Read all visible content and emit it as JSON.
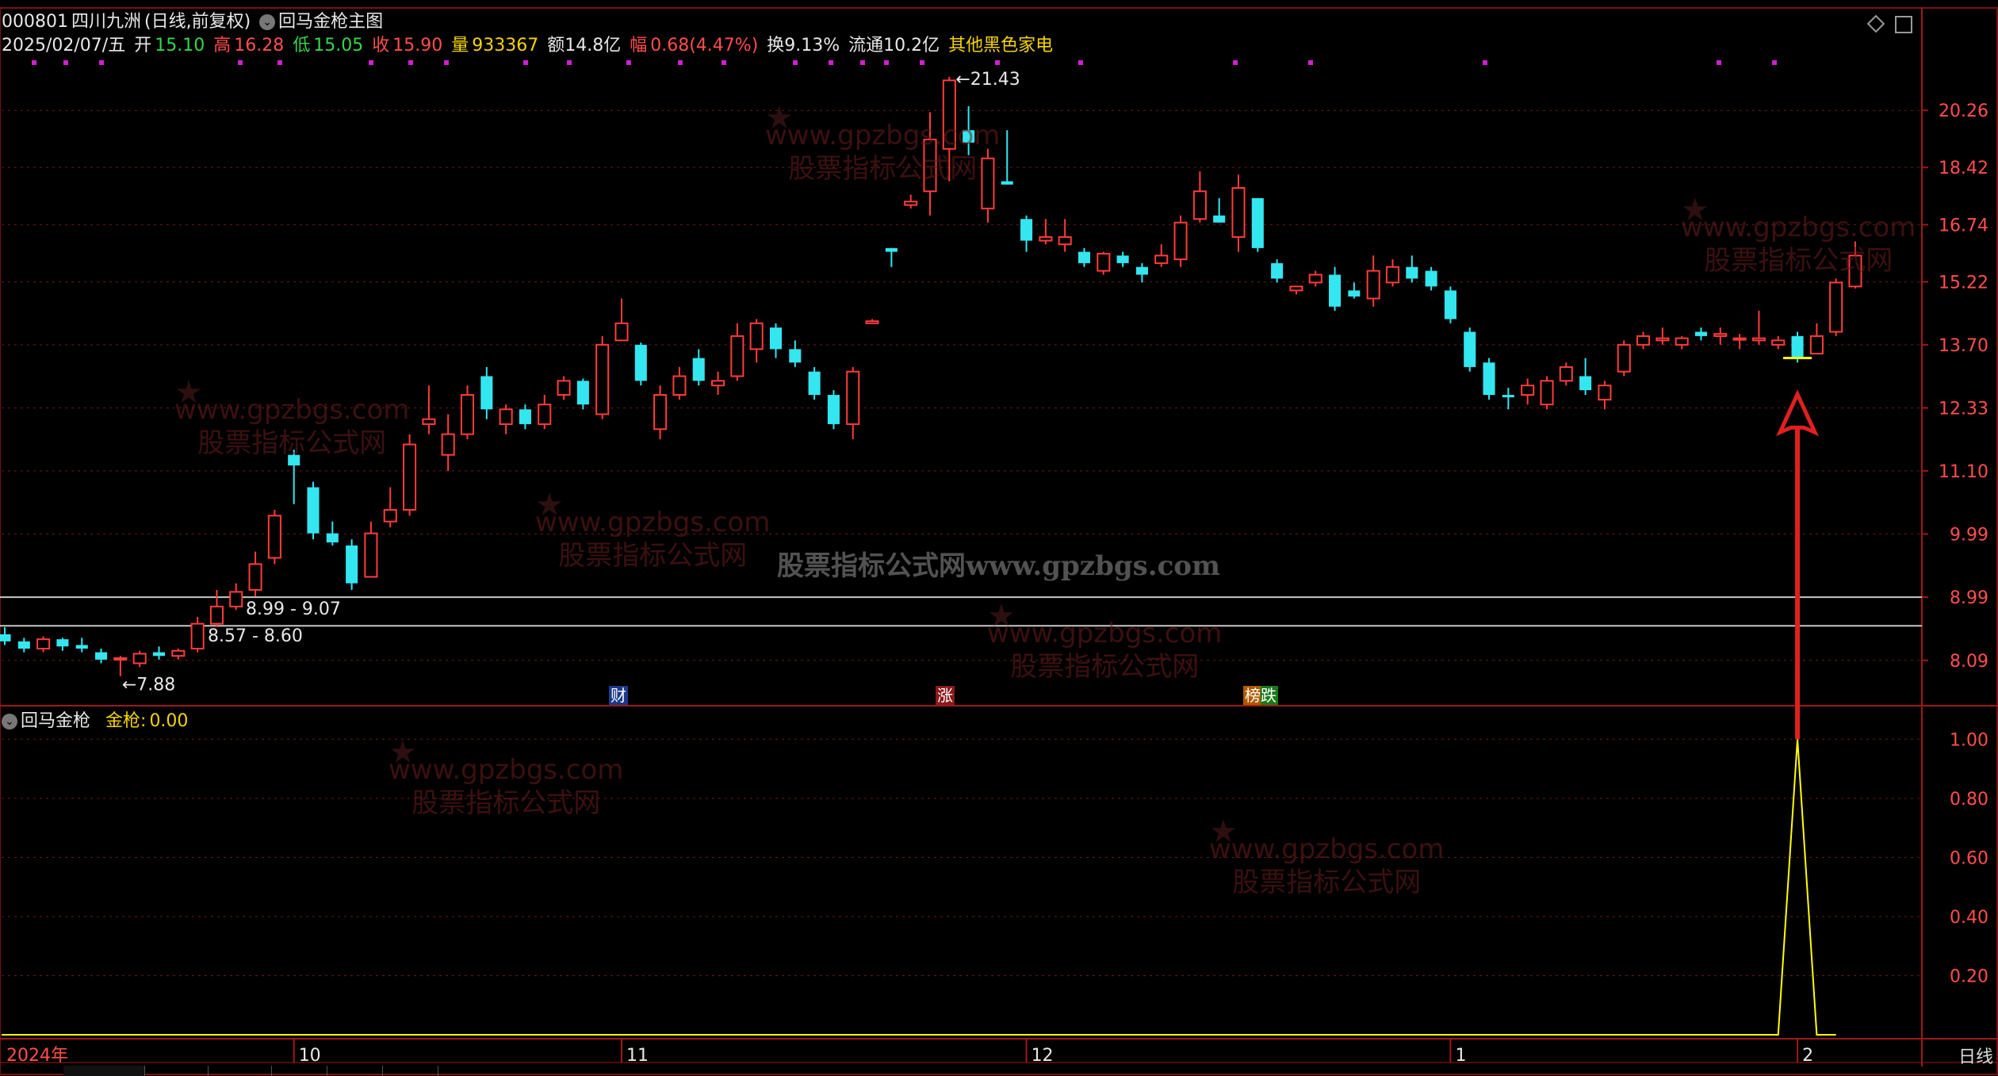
{
  "header": {
    "code": "000801",
    "name": "四川九洲",
    "period": "(日线,前复权)",
    "indicator_main": "回马金枪主图",
    "date": "2025/02/07/五",
    "open_label": "开",
    "open": "15.10",
    "high_label": "高",
    "high": "16.28",
    "low_label": "低",
    "low": "15.05",
    "close_label": "收",
    "close": "15.90",
    "vol_label": "量",
    "vol": "933367",
    "amount": "额14.8亿",
    "change_label": "幅",
    "change": "0.68(4.47%)",
    "turnover": "换9.13%",
    "float_cap": "流通10.2亿",
    "concept": "其他黑色家电"
  },
  "sub_header": {
    "indicator": "回马金枪",
    "value_label": "金枪:",
    "value": "0.00"
  },
  "price_axis": [
    "20.26",
    "18.42",
    "16.74",
    "15.22",
    "13.70",
    "12.33",
    "11.10",
    "9.99",
    "8.99",
    "8.09"
  ],
  "sub_axis": [
    "1.00",
    "0.80",
    "0.60",
    "0.40",
    "0.20"
  ],
  "x_axis": {
    "year": "2024年",
    "months": [
      "10",
      "11",
      "12",
      "1",
      "2"
    ],
    "period_button": "日线"
  },
  "annotations": {
    "peak": "21.43",
    "low": "7.88",
    "band_upper": "8.99 - 9.07",
    "band_lower": "8.57 - 8.60"
  },
  "badges": [
    "财",
    "涨",
    "榜跌"
  ],
  "watermark": {
    "url": "www.gpzbgs.com",
    "name": "股票指标公式网",
    "center": "股票指标公式网www.gpzbgs.com"
  },
  "colors": {
    "up": "#ff3b3b",
    "down": "#33e6f0",
    "signal": "#ffff00",
    "grid": "#6a1a1a",
    "arrow": "#e02020"
  },
  "chart_data": [
    {
      "type": "candlestick",
      "title": "四川九洲(日线,前复权)",
      "y_scale": "log",
      "ylim": [
        7.6,
        22.5
      ],
      "candles": [
        {
          "o": 8.45,
          "h": 8.55,
          "l": 8.3,
          "c": 8.35
        },
        {
          "o": 8.35,
          "h": 8.4,
          "l": 8.2,
          "c": 8.25
        },
        {
          "o": 8.25,
          "h": 8.42,
          "l": 8.2,
          "c": 8.38
        },
        {
          "o": 8.38,
          "h": 8.4,
          "l": 8.22,
          "c": 8.28
        },
        {
          "o": 8.3,
          "h": 8.4,
          "l": 8.2,
          "c": 8.25
        },
        {
          "o": 8.2,
          "h": 8.25,
          "l": 8.05,
          "c": 8.1
        },
        {
          "o": 8.1,
          "h": 8.15,
          "l": 7.88,
          "c": 8.12
        },
        {
          "o": 8.05,
          "h": 8.22,
          "l": 8.0,
          "c": 8.18
        },
        {
          "o": 8.2,
          "h": 8.28,
          "l": 8.1,
          "c": 8.15
        },
        {
          "o": 8.15,
          "h": 8.25,
          "l": 8.1,
          "c": 8.22
        },
        {
          "o": 8.25,
          "h": 8.7,
          "l": 8.2,
          "c": 8.6
        },
        {
          "o": 8.6,
          "h": 9.1,
          "l": 8.55,
          "c": 8.85
        },
        {
          "o": 8.85,
          "h": 9.2,
          "l": 8.8,
          "c": 9.07
        },
        {
          "o": 9.1,
          "h": 9.7,
          "l": 9.0,
          "c": 9.5
        },
        {
          "o": 9.6,
          "h": 10.4,
          "l": 9.5,
          "c": 10.3
        },
        {
          "o": 11.4,
          "h": 11.5,
          "l": 10.5,
          "c": 11.2
        },
        {
          "o": 10.8,
          "h": 10.9,
          "l": 9.9,
          "c": 10.0
        },
        {
          "o": 10.0,
          "h": 10.2,
          "l": 9.8,
          "c": 9.85
        },
        {
          "o": 9.8,
          "h": 9.9,
          "l": 9.1,
          "c": 9.2
        },
        {
          "o": 9.3,
          "h": 10.2,
          "l": 9.3,
          "c": 10.0
        },
        {
          "o": 10.2,
          "h": 10.8,
          "l": 10.1,
          "c": 10.4
        },
        {
          "o": 10.4,
          "h": 11.8,
          "l": 10.3,
          "c": 11.6
        },
        {
          "o": 12.0,
          "h": 12.8,
          "l": 11.8,
          "c": 12.1
        },
        {
          "o": 11.4,
          "h": 12.2,
          "l": 11.1,
          "c": 11.8
        },
        {
          "o": 11.8,
          "h": 12.8,
          "l": 11.7,
          "c": 12.6
        },
        {
          "o": 13.0,
          "h": 13.2,
          "l": 12.1,
          "c": 12.3
        },
        {
          "o": 12.0,
          "h": 12.4,
          "l": 11.8,
          "c": 12.3
        },
        {
          "o": 12.3,
          "h": 12.4,
          "l": 11.9,
          "c": 12.0
        },
        {
          "o": 12.0,
          "h": 12.6,
          "l": 11.9,
          "c": 12.4
        },
        {
          "o": 12.6,
          "h": 13.0,
          "l": 12.5,
          "c": 12.9
        },
        {
          "o": 12.9,
          "h": 12.95,
          "l": 12.3,
          "c": 12.4
        },
        {
          "o": 12.2,
          "h": 13.9,
          "l": 12.1,
          "c": 13.7
        },
        {
          "o": 13.8,
          "h": 14.8,
          "l": 13.8,
          "c": 14.2
        },
        {
          "o": 13.7,
          "h": 13.75,
          "l": 12.8,
          "c": 12.9
        },
        {
          "o": 11.9,
          "h": 12.8,
          "l": 11.7,
          "c": 12.6
        },
        {
          "o": 12.6,
          "h": 13.2,
          "l": 12.5,
          "c": 13.0
        },
        {
          "o": 13.4,
          "h": 13.6,
          "l": 12.8,
          "c": 12.9
        },
        {
          "o": 12.8,
          "h": 13.1,
          "l": 12.6,
          "c": 12.9
        },
        {
          "o": 13.0,
          "h": 14.2,
          "l": 12.9,
          "c": 13.9
        },
        {
          "o": 13.6,
          "h": 14.3,
          "l": 13.3,
          "c": 14.2
        },
        {
          "o": 14.1,
          "h": 14.2,
          "l": 13.4,
          "c": 13.6
        },
        {
          "o": 13.6,
          "h": 13.8,
          "l": 13.2,
          "c": 13.3
        },
        {
          "o": 13.1,
          "h": 13.2,
          "l": 12.5,
          "c": 12.6
        },
        {
          "o": 12.6,
          "h": 12.7,
          "l": 11.9,
          "c": 12.0
        },
        {
          "o": 12.0,
          "h": 13.2,
          "l": 11.7,
          "c": 13.1
        },
        {
          "o": 14.2,
          "h": 14.3,
          "l": 14.2,
          "c": 14.25
        },
        {
          "o": 16.1,
          "h": 16.1,
          "l": 15.6,
          "c": 16.0
        },
        {
          "o": 17.3,
          "h": 17.6,
          "l": 17.2,
          "c": 17.4
        },
        {
          "o": 17.7,
          "h": 20.2,
          "l": 17.0,
          "c": 19.3
        },
        {
          "o": 19.0,
          "h": 21.43,
          "l": 18.0,
          "c": 21.3
        },
        {
          "o": 19.6,
          "h": 20.4,
          "l": 18.8,
          "c": 19.2
        },
        {
          "o": 17.2,
          "h": 19.0,
          "l": 16.8,
          "c": 18.7
        },
        {
          "o": 18.0,
          "h": 19.6,
          "l": 17.9,
          "c": 17.9
        },
        {
          "o": 16.9,
          "h": 17.0,
          "l": 16.0,
          "c": 16.3
        },
        {
          "o": 16.3,
          "h": 16.9,
          "l": 16.2,
          "c": 16.4
        },
        {
          "o": 16.2,
          "h": 16.9,
          "l": 16.0,
          "c": 16.4
        },
        {
          "o": 16.0,
          "h": 16.1,
          "l": 15.6,
          "c": 15.7
        },
        {
          "o": 15.5,
          "h": 16.0,
          "l": 15.4,
          "c": 15.95
        },
        {
          "o": 15.9,
          "h": 16.0,
          "l": 15.6,
          "c": 15.7
        },
        {
          "o": 15.6,
          "h": 15.7,
          "l": 15.2,
          "c": 15.4
        },
        {
          "o": 15.7,
          "h": 16.2,
          "l": 15.6,
          "c": 15.9
        },
        {
          "o": 15.8,
          "h": 17.0,
          "l": 15.6,
          "c": 16.8
        },
        {
          "o": 16.9,
          "h": 18.3,
          "l": 16.8,
          "c": 17.7
        },
        {
          "o": 17.0,
          "h": 17.5,
          "l": 16.8,
          "c": 16.8
        },
        {
          "o": 16.4,
          "h": 18.2,
          "l": 16.0,
          "c": 17.8
        },
        {
          "o": 17.5,
          "h": 17.5,
          "l": 16.0,
          "c": 16.1
        },
        {
          "o": 15.7,
          "h": 15.8,
          "l": 15.2,
          "c": 15.3
        },
        {
          "o": 15.0,
          "h": 15.1,
          "l": 14.9,
          "c": 15.1
        },
        {
          "o": 15.2,
          "h": 15.5,
          "l": 15.1,
          "c": 15.4
        },
        {
          "o": 15.4,
          "h": 15.6,
          "l": 14.5,
          "c": 14.6
        },
        {
          "o": 15.0,
          "h": 15.2,
          "l": 14.8,
          "c": 14.85
        },
        {
          "o": 14.8,
          "h": 15.9,
          "l": 14.6,
          "c": 15.5
        },
        {
          "o": 15.2,
          "h": 15.8,
          "l": 15.1,
          "c": 15.6
        },
        {
          "o": 15.6,
          "h": 15.9,
          "l": 15.2,
          "c": 15.3
        },
        {
          "o": 15.5,
          "h": 15.6,
          "l": 15.0,
          "c": 15.1
        },
        {
          "o": 15.0,
          "h": 15.1,
          "l": 14.2,
          "c": 14.3
        },
        {
          "o": 14.0,
          "h": 14.1,
          "l": 13.1,
          "c": 13.2
        },
        {
          "o": 13.3,
          "h": 13.4,
          "l": 12.5,
          "c": 12.6
        },
        {
          "o": 12.6,
          "h": 12.75,
          "l": 12.3,
          "c": 12.55
        },
        {
          "o": 12.6,
          "h": 12.95,
          "l": 12.4,
          "c": 12.8
        },
        {
          "o": 12.4,
          "h": 13.0,
          "l": 12.3,
          "c": 12.9
        },
        {
          "o": 12.9,
          "h": 13.3,
          "l": 12.8,
          "c": 13.2
        },
        {
          "o": 13.0,
          "h": 13.4,
          "l": 12.6,
          "c": 12.7
        },
        {
          "o": 12.5,
          "h": 12.9,
          "l": 12.3,
          "c": 12.8
        },
        {
          "o": 13.1,
          "h": 13.8,
          "l": 13.0,
          "c": 13.7
        },
        {
          "o": 13.7,
          "h": 14.0,
          "l": 13.6,
          "c": 13.9
        },
        {
          "o": 13.8,
          "h": 14.1,
          "l": 13.7,
          "c": 13.85
        },
        {
          "o": 13.7,
          "h": 13.9,
          "l": 13.6,
          "c": 13.85
        },
        {
          "o": 14.0,
          "h": 14.1,
          "l": 13.8,
          "c": 13.9
        },
        {
          "o": 13.9,
          "h": 14.1,
          "l": 13.7,
          "c": 13.95
        },
        {
          "o": 13.85,
          "h": 13.95,
          "l": 13.6,
          "c": 13.85
        },
        {
          "o": 13.8,
          "h": 14.5,
          "l": 13.7,
          "c": 13.85
        },
        {
          "o": 13.7,
          "h": 13.9,
          "l": 13.6,
          "c": 13.8
        },
        {
          "o": 13.9,
          "h": 14.0,
          "l": 13.3,
          "c": 13.4
        },
        {
          "o": 13.5,
          "h": 14.2,
          "l": 13.5,
          "c": 13.9
        },
        {
          "o": 14.0,
          "h": 15.3,
          "l": 13.9,
          "c": 15.2
        },
        {
          "o": 15.1,
          "h": 16.28,
          "l": 15.05,
          "c": 15.9
        }
      ],
      "support_lines": [
        8.99,
        8.57
      ]
    },
    {
      "type": "line",
      "title": "回马金枪",
      "series": [
        {
          "name": "金枪",
          "values": [
            0,
            0,
            0,
            0,
            0,
            0,
            0,
            0,
            0,
            0,
            0,
            0,
            0,
            0,
            0,
            0,
            0,
            0,
            0,
            0,
            0,
            0,
            0,
            0,
            0,
            0,
            0,
            0,
            0,
            0,
            0,
            0,
            0,
            0,
            0,
            0,
            0,
            0,
            0,
            0,
            0,
            0,
            0,
            0,
            0,
            0,
            0,
            0,
            0,
            0,
            0,
            0,
            0,
            0,
            0,
            0,
            0,
            0,
            0,
            0,
            0,
            0,
            0,
            0,
            0,
            0,
            0,
            0,
            0,
            0,
            0,
            0,
            0,
            0,
            0,
            0,
            0,
            0,
            0,
            0,
            0,
            0,
            0,
            0,
            0,
            0,
            0,
            0,
            0,
            0,
            0,
            0,
            0,
            1,
            0,
            0
          ]
        }
      ],
      "ylim": [
        0,
        1.1
      ]
    }
  ]
}
